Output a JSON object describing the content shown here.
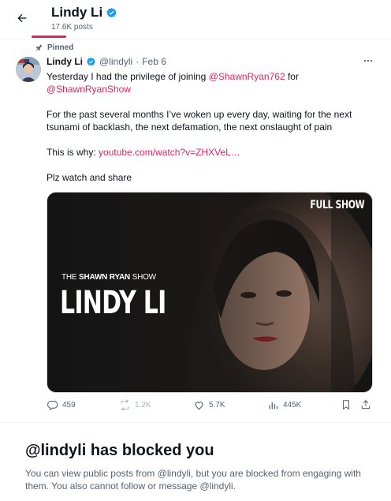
{
  "header": {
    "name": "Lindy Li",
    "post_count": "17.6K posts"
  },
  "tweet": {
    "pinned_label": "Pinned",
    "author_name": "Lindy Li",
    "handle": "@lindyli",
    "separator": "·",
    "date": "Feb 6",
    "line1_prefix": "Yesterday I had the privilege of joining ",
    "mention1": "@ShawnRyan762",
    "line1_suffix": " for",
    "mention2": "@ShawnRyanShow",
    "paragraph2": "For the past several months I’ve woken up every day, waiting for the next tsunami of backlash, the next defamation, the next onslaught of pain",
    "why_prefix": "This is why: ",
    "link": "youtube.com/watch?v=ZHXVeL…",
    "closing": "Plz watch and share",
    "media": {
      "badge": "FULL SHOW",
      "show_prefix": "THE ",
      "show_name": "SHAWN RYAN",
      "show_suffix": " SHOW",
      "guest": "LINDY LI"
    },
    "stats": {
      "replies": "459",
      "reposts": "1.2K",
      "likes": "5.7K",
      "views": "445K"
    }
  },
  "blocked": {
    "title": "@lindyli has blocked you",
    "message": "You can view public posts from @lindyli, but you are blocked from engaging with them. You also cannot follow or message @lindyli."
  },
  "colors": {
    "accent": "#e0245e",
    "verified": "#1d9bf0",
    "muted": "#536471"
  }
}
